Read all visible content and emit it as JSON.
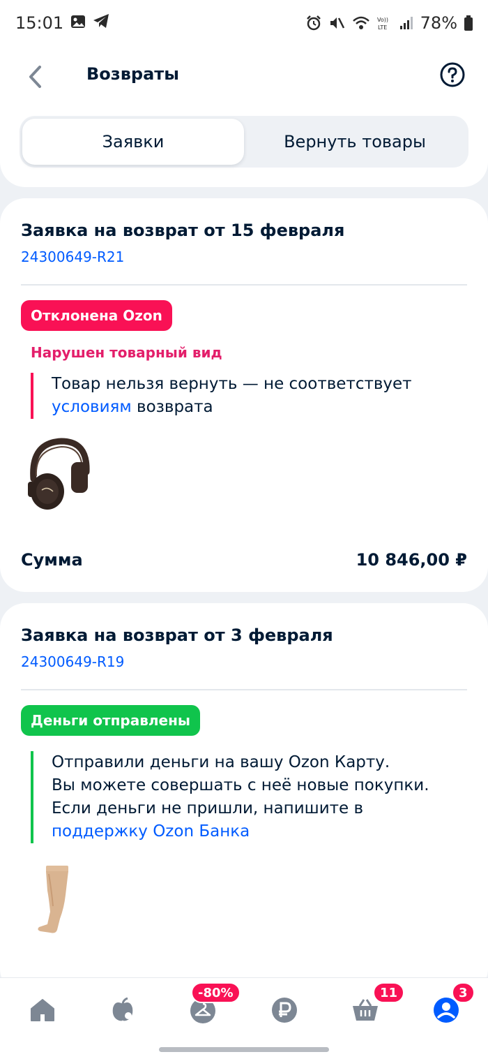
{
  "status_bar": {
    "time": "15:01",
    "battery": "78%"
  },
  "header": {
    "title": "Возвраты",
    "tabs": [
      {
        "label": "Заявки",
        "active": true
      },
      {
        "label": "Вернуть товары",
        "active": false
      }
    ]
  },
  "returns": [
    {
      "title": "Заявка на возврат от 15 февраля",
      "id": "24300649-R21",
      "status": "Отклонена Ozon",
      "status_color": "#f91155",
      "reason": "Нарушен товарный вид",
      "message_part1": "Товар нельзя вернуть — не соответствует ",
      "message_link": "условиям",
      "message_part2": " возврата",
      "product": "headphones",
      "sum_label": "Сумма",
      "sum_value": "10 846,00 ₽"
    },
    {
      "title": "Заявка на возврат от 3 февраля",
      "id": "24300649-R19",
      "status": "Деньги отправлены",
      "status_color": "#10c44c",
      "message_lines": [
        "Отправили деньги на вашу Ozon Карту.",
        "Вы можете совершать с неё новые покупки.",
        "Если деньги не пришли, напишите в"
      ],
      "message_link": "поддержку Ozon Банка",
      "product": "stocking"
    }
  ],
  "bottom_nav": {
    "items": [
      {
        "icon": "home-icon"
      },
      {
        "icon": "fresh-icon"
      },
      {
        "icon": "hanger-icon",
        "badge": "-80%"
      },
      {
        "icon": "ruble-icon"
      },
      {
        "icon": "cart-icon",
        "badge": "11"
      },
      {
        "icon": "profile-icon",
        "badge": "3"
      }
    ]
  },
  "colors": {
    "accent": "#005bff",
    "danger": "#f91155",
    "success": "#10c44c"
  }
}
